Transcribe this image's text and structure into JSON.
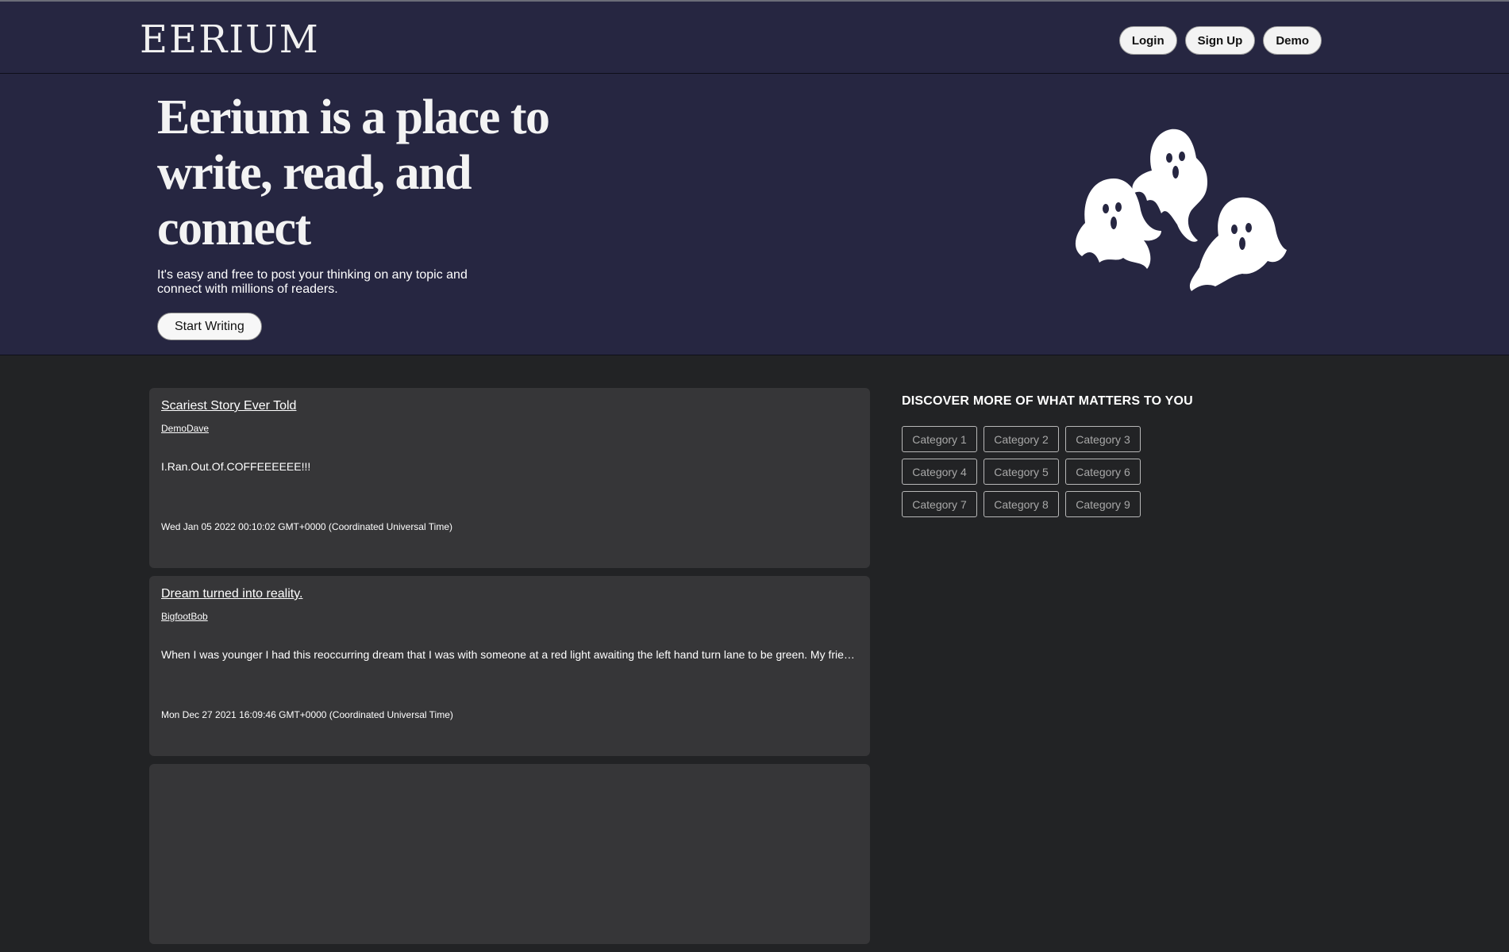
{
  "nav": {
    "logo": "EERIUM",
    "login": "Login",
    "signup": "Sign Up",
    "demo": "Demo"
  },
  "hero": {
    "headline": "Eerium is a place to write, read, and connect",
    "subtext": "It's easy and free to post your thinking on any topic and connect with millions of readers.",
    "cta": "Start Writing",
    "illustration": "ghosts-icon"
  },
  "stories": [
    {
      "title": "Scariest Story Ever Told",
      "author": "DemoDave",
      "excerpt": "I.Ran.Out.Of.COFFEEEEEE!!!",
      "date": "Wed Jan 05 2022 00:10:02 GMT+0000 (Coordinated Universal Time)"
    },
    {
      "title": "Dream turned into reality.",
      "author": "BigfootBob",
      "excerpt": "When I was younger I had this reoccurring dream that I was with someone at a red light awaiting the left hand turn lane to be green. My friend was driving and then the light turned green.",
      "date": "Mon Dec 27 2021 16:09:46 GMT+0000 (Coordinated Universal Time)"
    }
  ],
  "discover": {
    "heading": "DISCOVER MORE OF WHAT MATTERS TO YOU",
    "categories": [
      "Category 1",
      "Category 2",
      "Category 3",
      "Category 4",
      "Category 5",
      "Category 6",
      "Category 7",
      "Category 8",
      "Category 9"
    ]
  },
  "colors": {
    "navy": "#262641",
    "page_bg": "#222325",
    "card_bg": "#363638"
  }
}
